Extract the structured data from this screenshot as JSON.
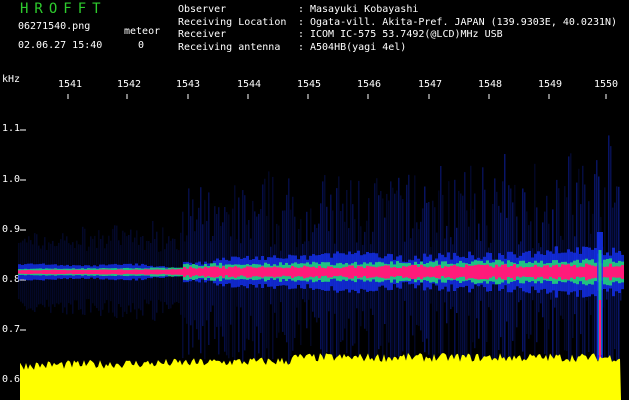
{
  "header": {
    "app_title": "HROFFT",
    "file_name": "06271540.png",
    "datetime": "02.06.27 15:40",
    "meteor_label": "meteor",
    "meteor_count": "0"
  },
  "info": [
    {
      "key": "Observer",
      "value": "Masayuki Kobayashi"
    },
    {
      "key": "Receiving Location",
      "value": "Ogata-vill. Akita-Pref. JAPAN (139.9303E, 40.0231N)"
    },
    {
      "key": "Receiver",
      "value": "ICOM IC-575 53.7492(@LCD)MHz USB"
    },
    {
      "key": "Receiving antenna",
      "value": "A504HB(yagi 4el)"
    }
  ],
  "axes": {
    "y_unit": "kHz",
    "y_ticks": [
      "1.1",
      "1.0",
      "0.9",
      "0.8",
      "0.7",
      "0.6"
    ],
    "x_ticks": [
      "1541",
      "1542",
      "1543",
      "1544",
      "1545",
      "1546",
      "1547",
      "1548",
      "1549",
      "1550"
    ]
  },
  "colors": {
    "background": "#000000",
    "title": "#2ecc2e",
    "text": "#ffffff",
    "spectrum_core": "#ff1a7a",
    "spectrum_mid": "#22d27a",
    "spectrum_outer": "#1533ff",
    "noise_floor": "#ffff00"
  }
}
